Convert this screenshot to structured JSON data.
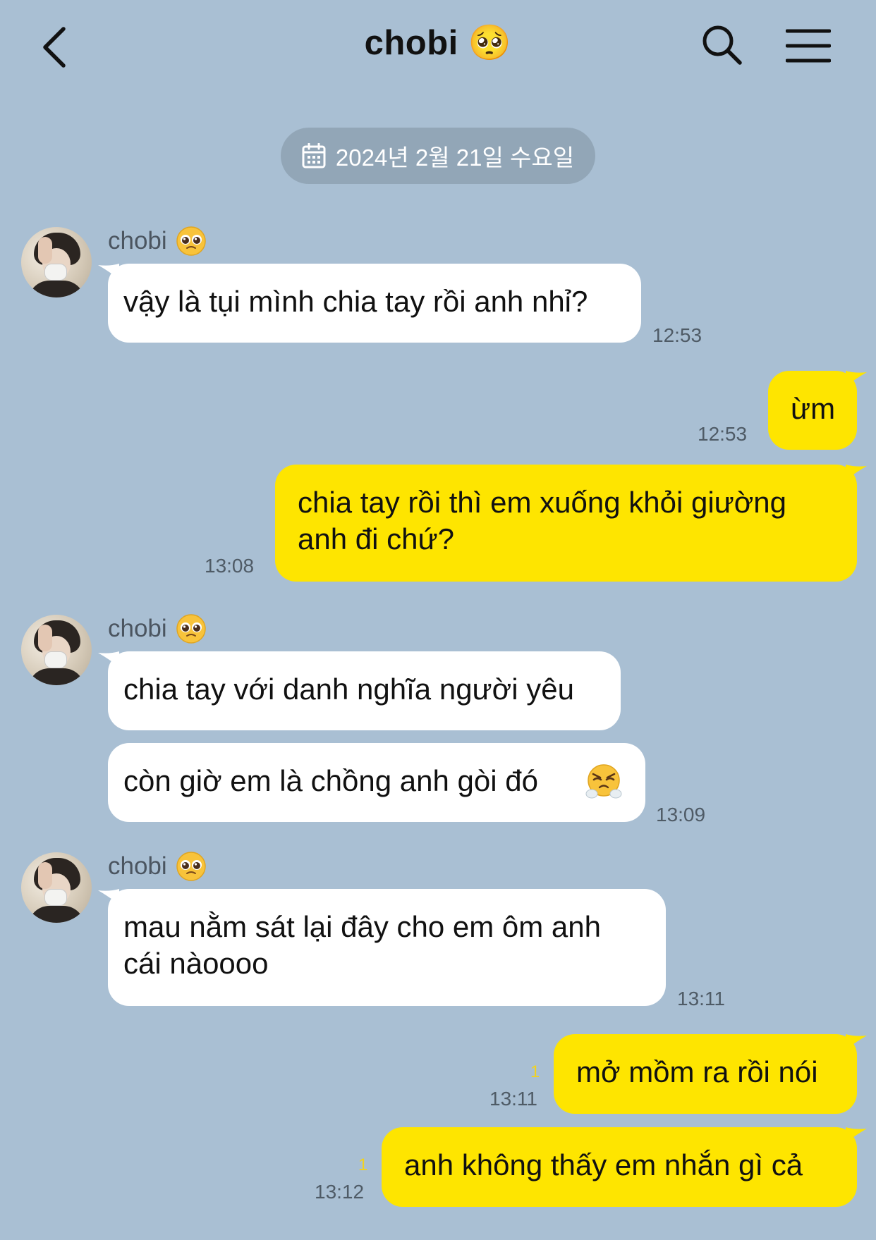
{
  "header": {
    "title": "chobi 🥺"
  },
  "date_divider": "2024년 2월 21일 수요일",
  "sender": {
    "name": "chobi"
  },
  "messages": [
    {
      "text": "vậy là tụi mình chia tay rồi anh nhỉ?",
      "time": "12:53"
    },
    {
      "text": "ừm",
      "time": "12:53"
    },
    {
      "line1": "chia tay rồi thì em xuống khỏi giường",
      "line2": "anh đi chứ?",
      "time": "13:08"
    },
    {
      "text": "chia tay với danh nghĩa người yêu"
    },
    {
      "text": "còn giờ em là chồng anh gòi đó",
      "time": "13:09"
    },
    {
      "line1": "mau nằm sát lại đây cho em ôm anh",
      "line2": "cái nàoooo",
      "time": "13:11"
    },
    {
      "text": "mở mồm ra rồi nói",
      "time": "13:11",
      "unread": "1"
    },
    {
      "text": "anh không thấy em nhắn gì cả",
      "time": "13:12",
      "unread": "1"
    }
  ],
  "colors": {
    "background": "#a9bfd3",
    "incoming_bubble": "#ffffff",
    "outgoing_bubble": "#fee500",
    "date_pill": "#92a6b7",
    "unread_count": "#f2d21e"
  },
  "icons": [
    "back-arrow-icon",
    "search-icon",
    "menu-icon",
    "calendar-icon",
    "pleading-face-emoji",
    "huffing-face-emoji"
  ]
}
